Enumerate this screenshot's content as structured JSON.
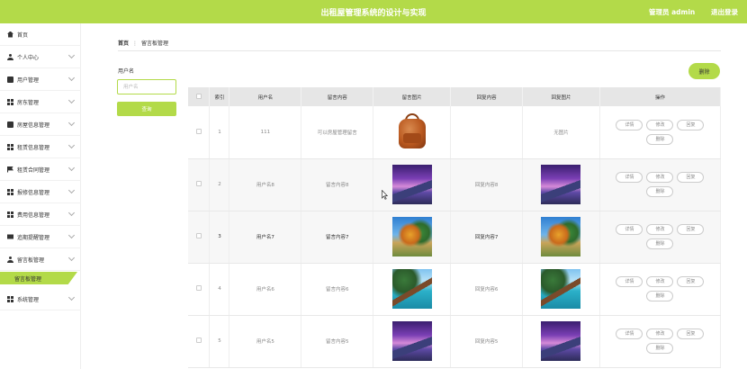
{
  "header": {
    "title": "出租屋管理系统的设计与实现",
    "admin_label": "管理员 admin",
    "logout_label": "退出登录",
    "accent_color": "#b3da49"
  },
  "sidebar": {
    "items": [
      {
        "label": "首页",
        "icon": "home-icon",
        "has_arrow": false
      },
      {
        "label": "个人中心",
        "icon": "user-icon",
        "has_arrow": true
      },
      {
        "label": "用户管理",
        "icon": "briefcase-icon",
        "has_arrow": true
      },
      {
        "label": "房东管理",
        "icon": "grid-icon",
        "has_arrow": true
      },
      {
        "label": "房屋信息管理",
        "icon": "briefcase-icon",
        "has_arrow": true
      },
      {
        "label": "租赁信息管理",
        "icon": "grid-icon",
        "has_arrow": true
      },
      {
        "label": "租赁合同管理",
        "icon": "flag-icon",
        "has_arrow": true
      },
      {
        "label": "报修信息管理",
        "icon": "grid-icon",
        "has_arrow": true
      },
      {
        "label": "费用信息管理",
        "icon": "grid-icon",
        "has_arrow": true
      },
      {
        "label": "追期提醒管理",
        "icon": "card-icon",
        "has_arrow": true
      },
      {
        "label": "留言板管理",
        "icon": "user-icon",
        "has_arrow": true
      },
      {
        "label": "系统管理",
        "icon": "grid-icon",
        "has_arrow": true
      }
    ],
    "active_sub": "留言板管理"
  },
  "breadcrumb": {
    "home": "首页",
    "separator": "⋮",
    "current": "留言板管理"
  },
  "search": {
    "label": "用户名",
    "placeholder": "用户名",
    "button": "查询"
  },
  "toolbar": {
    "delete_label": "删除"
  },
  "table": {
    "columns": [
      "",
      "索引",
      "用户名",
      "留言内容",
      "留言图片",
      "回复内容",
      "回复图片",
      "操作"
    ],
    "rows": [
      {
        "index": "1",
        "username": "111",
        "content": "可以房屋管理留言",
        "image": "backpack-image",
        "reply": "",
        "reply_image": "无图片"
      },
      {
        "index": "2",
        "username": "用户名8",
        "content": "留言内容8",
        "image": "purple-landscape-image",
        "reply": "回复内容8",
        "reply_image": "purple-landscape-image"
      },
      {
        "index": "3",
        "username": "用户名7",
        "content": "留言内容7",
        "image": "autumn-landscape-image",
        "reply": "回复内容7",
        "reply_image": "autumn-landscape-image"
      },
      {
        "index": "4",
        "username": "用户名6",
        "content": "留言内容6",
        "image": "lake-pier-image",
        "reply": "回复内容6",
        "reply_image": "lake-pier-image"
      },
      {
        "index": "5",
        "username": "用户名5",
        "content": "留言内容5",
        "image": "purple-landscape-image",
        "reply": "回复内容5",
        "reply_image": "purple-landscape-image"
      }
    ],
    "actions": [
      "详情",
      "修改",
      "回复",
      "删除"
    ]
  }
}
